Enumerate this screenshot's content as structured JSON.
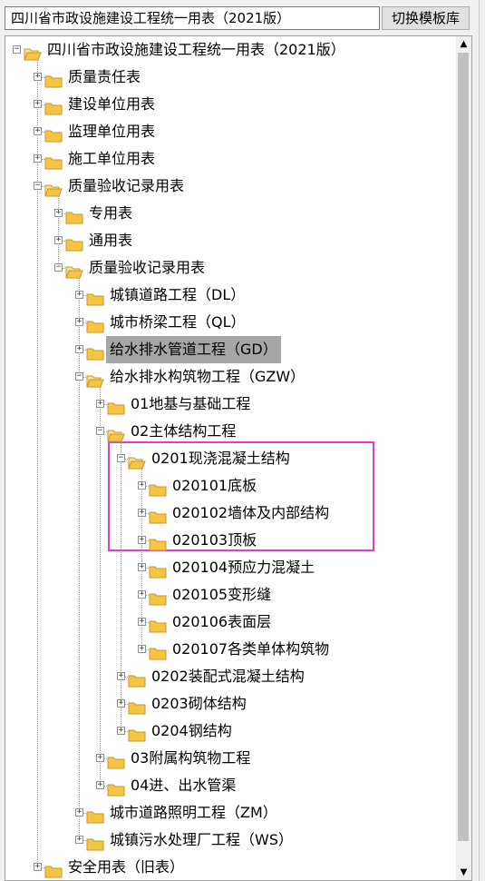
{
  "toolbar": {
    "template_value": "四川省市政设施建设工程统一用表（2021版）",
    "switch_label": "切换模板库"
  },
  "colors": {
    "folder": "#f5c542",
    "folder_stroke": "#c8962c",
    "highlight_box": "#e23ad9",
    "selected_row": "#a6a6a6"
  },
  "icons": {
    "closed": "folder-icon",
    "open": "folder-open-icon"
  },
  "tree": [
    {
      "level": 0,
      "label": "四川省市政设施建设工程统一用表（2021版）",
      "expanded": true
    },
    {
      "level": 1,
      "label": "质量责任表",
      "expanded": false
    },
    {
      "level": 1,
      "label": "建设单位用表",
      "expanded": false
    },
    {
      "level": 1,
      "label": "监理单位用表",
      "expanded": false
    },
    {
      "level": 1,
      "label": "施工单位用表",
      "expanded": false
    },
    {
      "level": 1,
      "label": "质量验收记录用表",
      "expanded": true
    },
    {
      "level": 2,
      "label": "专用表",
      "expanded": false
    },
    {
      "level": 2,
      "label": "通用表",
      "expanded": false
    },
    {
      "level": 2,
      "label": "质量验收记录用表",
      "expanded": true
    },
    {
      "level": 3,
      "label": "城镇道路工程（DL）",
      "expanded": false
    },
    {
      "level": 3,
      "label": "城市桥梁工程（QL）",
      "expanded": false
    },
    {
      "level": 3,
      "label": "给水排水管道工程（GD）",
      "expanded": false,
      "selected": true
    },
    {
      "level": 3,
      "label": "给水排水构筑物工程（GZW）",
      "expanded": true
    },
    {
      "level": 4,
      "label": "01地基与基础工程",
      "expanded": false
    },
    {
      "level": 4,
      "label": "02主体结构工程",
      "expanded": true
    },
    {
      "level": 5,
      "label": "0201现浇混凝土结构",
      "expanded": true
    },
    {
      "level": 6,
      "label": "020101底板",
      "expanded": false
    },
    {
      "level": 6,
      "label": "020102墙体及内部结构",
      "expanded": false
    },
    {
      "level": 6,
      "label": "020103顶板",
      "expanded": false
    },
    {
      "level": 6,
      "label": "020104预应力混凝土",
      "expanded": false
    },
    {
      "level": 6,
      "label": "020105变形缝",
      "expanded": false
    },
    {
      "level": 6,
      "label": "020106表面层",
      "expanded": false
    },
    {
      "level": 6,
      "label": "020107各类单体构筑物",
      "expanded": false
    },
    {
      "level": 5,
      "label": "0202装配式混凝土结构",
      "expanded": false
    },
    {
      "level": 5,
      "label": "0203砌体结构",
      "expanded": false
    },
    {
      "level": 5,
      "label": "0204钢结构",
      "expanded": false
    },
    {
      "level": 4,
      "label": "03附属构筑物工程",
      "expanded": false
    },
    {
      "level": 4,
      "label": "04进、出水管渠",
      "expanded": false
    },
    {
      "level": 3,
      "label": "城市道路照明工程（ZM）",
      "expanded": false
    },
    {
      "level": 3,
      "label": "城镇污水处理厂工程（WS）",
      "expanded": false
    },
    {
      "level": 1,
      "label": "安全用表（旧表）",
      "expanded": false
    }
  ]
}
